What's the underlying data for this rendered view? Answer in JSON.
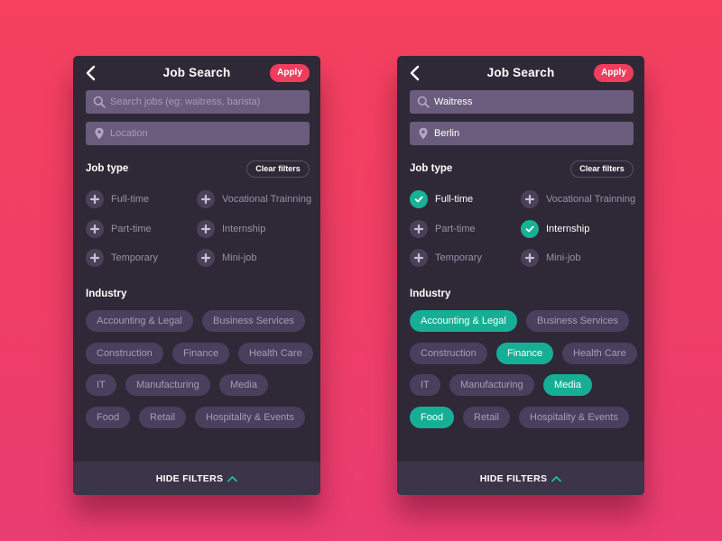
{
  "colors": {
    "accent_apply": "#F03D5E",
    "selected_green": "#17B197",
    "panel_bg": "#2F2937",
    "chip_bg": "#4A3F5C",
    "field_bg": "#6A5C7D"
  },
  "panels": [
    {
      "header": {
        "title": "Job Search",
        "back_icon": "chevron-left-icon",
        "apply_label": "Apply"
      },
      "search": {
        "icon": "search-icon",
        "value": "",
        "placeholder": "Search jobs (eg: waitress, barista)"
      },
      "location": {
        "icon": "location-pin-icon",
        "value": "",
        "placeholder": "Location"
      },
      "job_type": {
        "title": "Job type",
        "clear_label": "Clear filters",
        "options": [
          {
            "label": "Full-time",
            "selected": false
          },
          {
            "label": "Vocational Trainning",
            "selected": false
          },
          {
            "label": "Part-time",
            "selected": false
          },
          {
            "label": "Internship",
            "selected": false
          },
          {
            "label": "Temporary",
            "selected": false
          },
          {
            "label": "Mini-job",
            "selected": false
          }
        ]
      },
      "industry": {
        "title": "Industry",
        "chips": [
          {
            "label": "Accounting & Legal",
            "selected": false
          },
          {
            "label": "Business Services",
            "selected": false
          },
          {
            "label": "Construction",
            "selected": false
          },
          {
            "label": "Finance",
            "selected": false
          },
          {
            "label": "Health Care",
            "selected": false
          },
          {
            "label": "IT",
            "selected": false
          },
          {
            "label": "Manufacturing",
            "selected": false
          },
          {
            "label": "Media",
            "selected": false
          },
          {
            "label": "Food",
            "selected": false
          },
          {
            "label": "Retail",
            "selected": false
          },
          {
            "label": "Hospitality & Events",
            "selected": false
          }
        ]
      },
      "footer": {
        "label": "HIDE FILTERS",
        "icon": "chevron-up-icon"
      }
    },
    {
      "header": {
        "title": "Job Search",
        "back_icon": "chevron-left-icon",
        "apply_label": "Apply"
      },
      "search": {
        "icon": "search-icon",
        "value": "Waitress",
        "placeholder": "Search jobs (eg: waitress, barista)"
      },
      "location": {
        "icon": "location-pin-icon",
        "value": "Berlin",
        "placeholder": "Location"
      },
      "job_type": {
        "title": "Job type",
        "clear_label": "Clear filters",
        "options": [
          {
            "label": "Full-time",
            "selected": true
          },
          {
            "label": "Vocational Trainning",
            "selected": false
          },
          {
            "label": "Part-time",
            "selected": false
          },
          {
            "label": "Internship",
            "selected": true
          },
          {
            "label": "Temporary",
            "selected": false
          },
          {
            "label": "Mini-job",
            "selected": false
          }
        ]
      },
      "industry": {
        "title": "Industry",
        "chips": [
          {
            "label": "Accounting & Legal",
            "selected": true
          },
          {
            "label": "Business Services",
            "selected": false
          },
          {
            "label": "Construction",
            "selected": false
          },
          {
            "label": "Finance",
            "selected": true
          },
          {
            "label": "Health Care",
            "selected": false
          },
          {
            "label": "IT",
            "selected": false
          },
          {
            "label": "Manufacturing",
            "selected": false
          },
          {
            "label": "Media",
            "selected": true
          },
          {
            "label": "Food",
            "selected": true
          },
          {
            "label": "Retail",
            "selected": false
          },
          {
            "label": "Hospitality & Events",
            "selected": false
          }
        ]
      },
      "footer": {
        "label": "HIDE FILTERS",
        "icon": "chevron-up-icon"
      }
    }
  ]
}
